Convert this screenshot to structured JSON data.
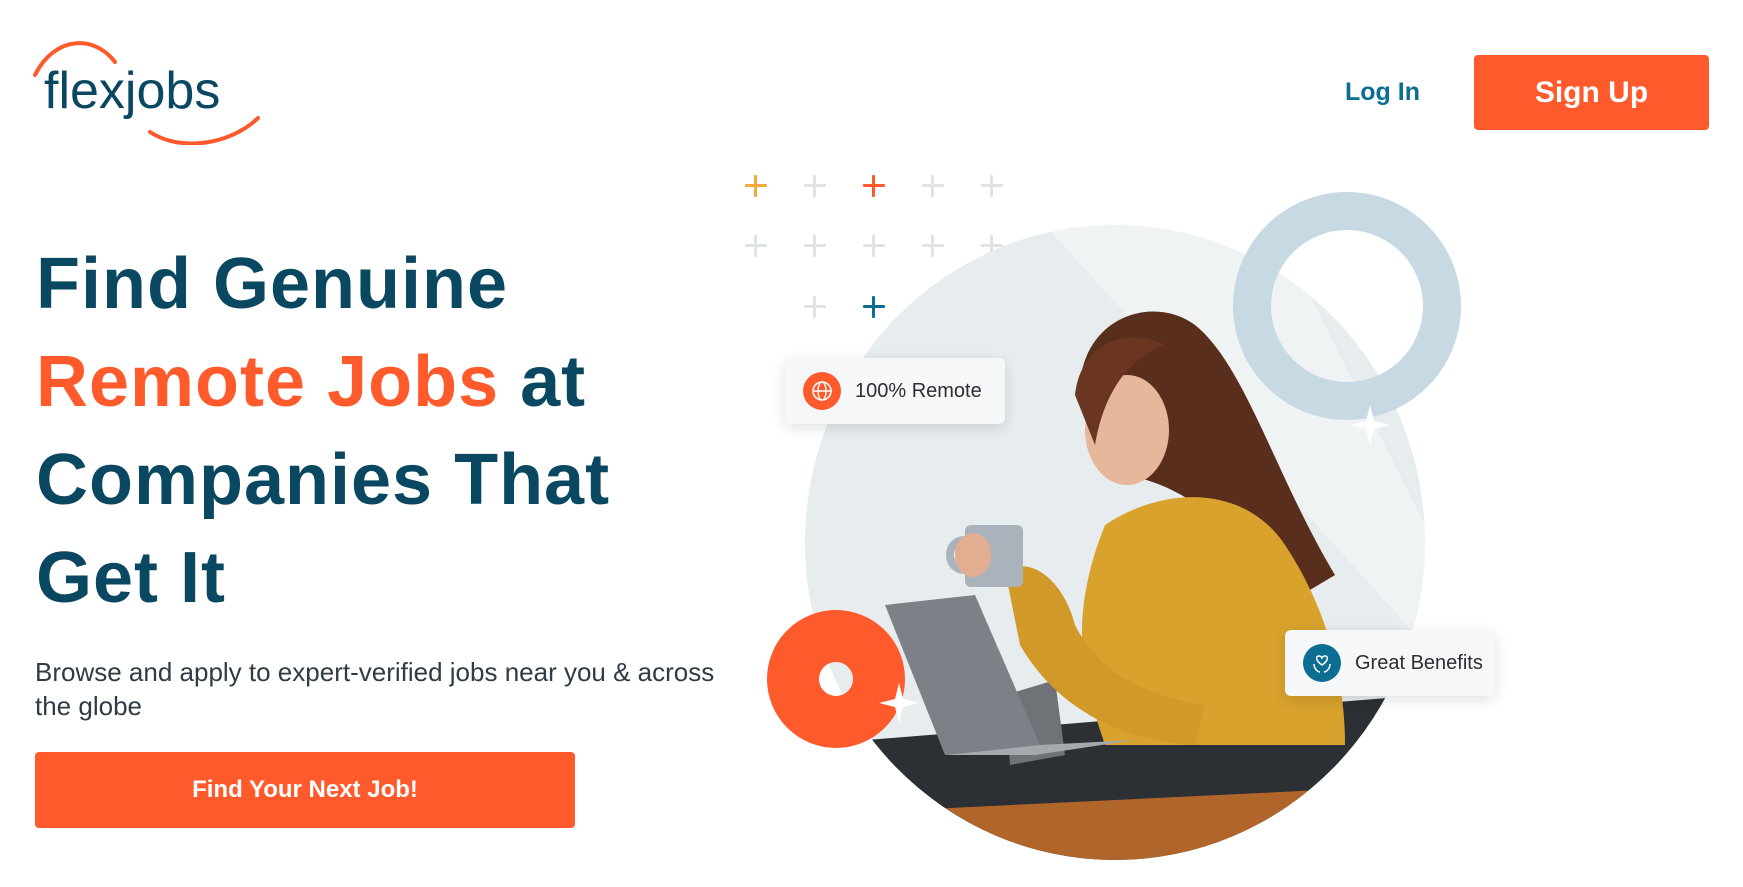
{
  "header": {
    "logo_text": "flexjobs",
    "login_label": "Log In",
    "signup_label": "Sign Up"
  },
  "hero": {
    "headline_line1": "Find Genuine",
    "headline_accent": "Remote Jobs",
    "headline_line2_rest": " at",
    "headline_line3": "Companies That",
    "headline_line4": "Get It",
    "subtitle": "Browse and apply to expert-verified jobs near you & across the globe",
    "cta_label": "Find Your Next Job!"
  },
  "illustration": {
    "card_remote_label": "100% Remote",
    "card_benefits_label": "Great Benefits"
  },
  "icons": {
    "logo": "flexjobs-logo",
    "globe": "globe-icon",
    "benefits": "heart-hands-icon"
  },
  "colors": {
    "brand_orange": "#ff5a2c",
    "brand_navy": "#0a4760",
    "link_blue": "#0b6e92",
    "ring_blue": "#c7dae3",
    "circle_bg": "#e7ecef"
  }
}
